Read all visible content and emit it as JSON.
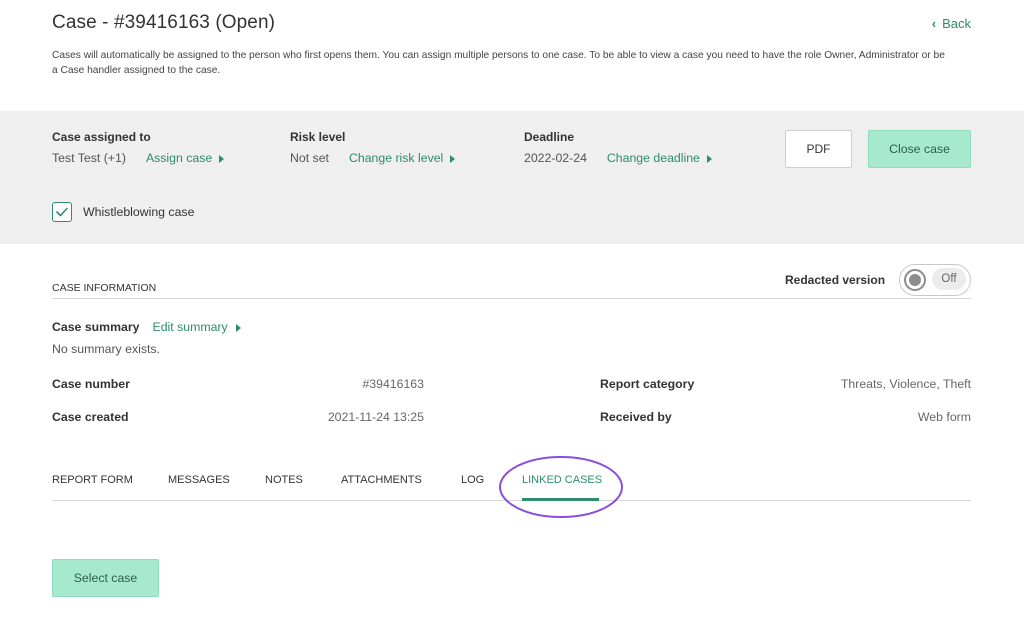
{
  "header": {
    "title": "Case - #39416163 (Open)",
    "back_label": "Back",
    "intro": "Cases will automatically be assigned to the person who first opens them. You can assign multiple persons to one case. To be able to view a case you need to have the role Owner, Administrator or be a Case handler assigned to the case."
  },
  "overview": {
    "assigned": {
      "label": "Case assigned to",
      "value": "Test Test (+1)",
      "action": "Assign case"
    },
    "risk": {
      "label": "Risk level",
      "value": "Not set",
      "action": "Change risk level"
    },
    "deadline": {
      "label": "Deadline",
      "value": "2022-02-24",
      "action": "Change deadline"
    },
    "pdf_label": "PDF",
    "close_label": "Close case",
    "whistleblowing": {
      "label": "Whistleblowing case",
      "checked": true
    }
  },
  "case_info": {
    "section_title": "CASE INFORMATION",
    "redacted_label": "Redacted version",
    "redacted_state": "Off",
    "summary_label": "Case summary",
    "summary_action": "Edit summary",
    "summary_text": "No summary exists.",
    "case_number_label": "Case number",
    "case_number": "#39416163",
    "case_created_label": "Case created",
    "case_created": "2021-11-24 13:25",
    "report_category_label": "Report category",
    "report_category": "Threats, Violence, Theft",
    "received_by_label": "Received by",
    "received_by": "Web form"
  },
  "tabs": [
    {
      "label": "REPORT FORM"
    },
    {
      "label": "MESSAGES"
    },
    {
      "label": "NOTES"
    },
    {
      "label": "ATTACHMENTS"
    },
    {
      "label": "LOG"
    },
    {
      "label": "LINKED CASES",
      "active": true
    }
  ],
  "linked_cases": {
    "select_label": "Select case"
  },
  "colors": {
    "accent": "#2e8b6e",
    "button_green": "#a7e9cf",
    "band": "#efefef",
    "highlight_ellipse": "#8a4de0"
  }
}
